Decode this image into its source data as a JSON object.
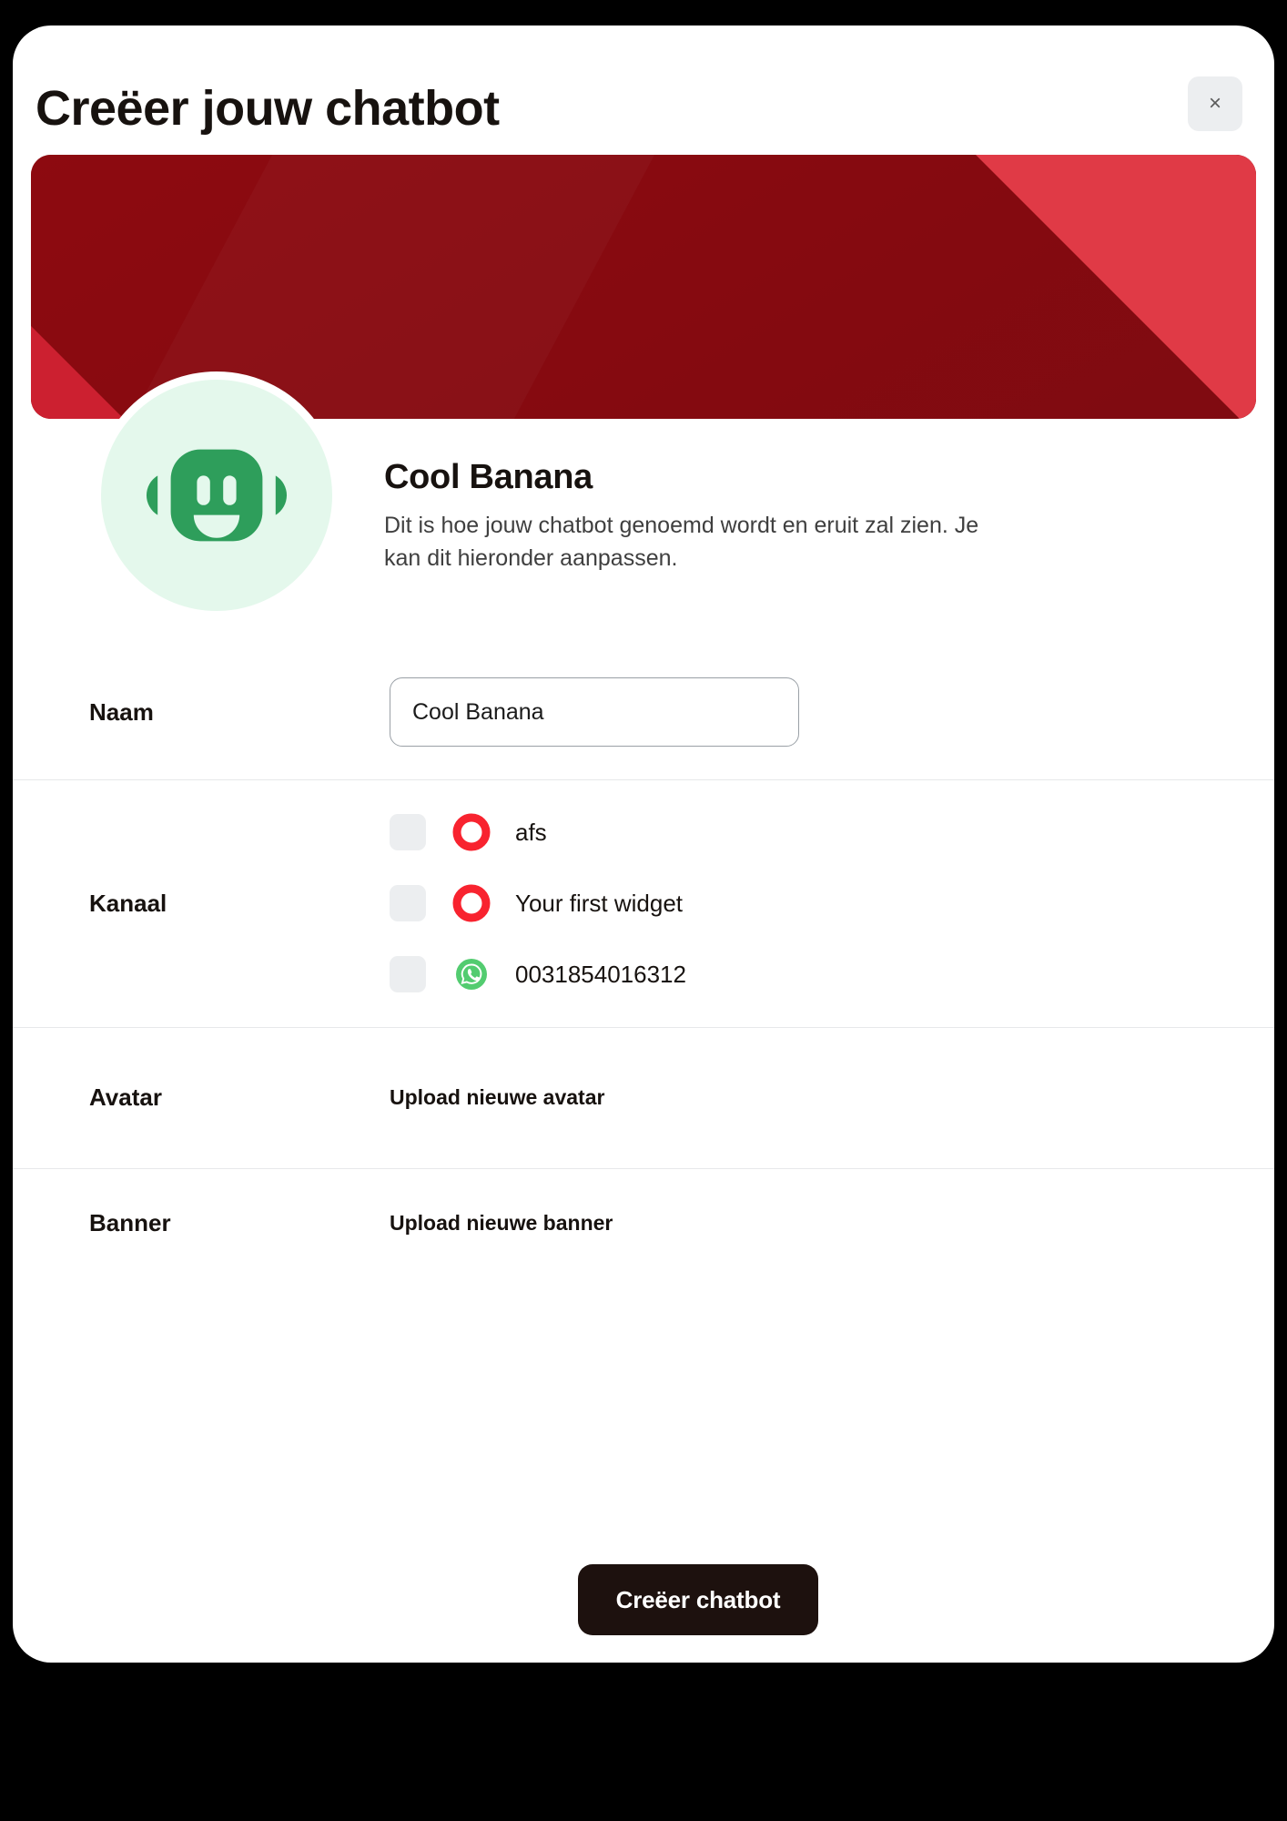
{
  "modal": {
    "title": "Creëer jouw chatbot",
    "close_label": "×",
    "close_icon": "close-icon"
  },
  "banner": {
    "base_color": "#8a0a10",
    "accent_color": "#e03a46",
    "accent_color_2": "#cc2030"
  },
  "identity": {
    "avatar_icon": "robot-icon",
    "avatar_bg_color": "#e4f8ec",
    "avatar_fg_color": "#2e9e5b",
    "name": "Cool Banana",
    "description_line_1": "Dit is hoe jouw chatbot genoemd wordt en eruit zal zien.",
    "description_line_2": "Je kan dit hieronder aanpassen."
  },
  "form": {
    "naam": {
      "label": "Naam",
      "value": "Cool Banana",
      "placeholder": "Cool Banana"
    },
    "kanaal": {
      "label": "Kanaal",
      "items": [
        {
          "label": "afs",
          "icon": "widget-icon",
          "icon_color": "#f8232f",
          "checked": false
        },
        {
          "label": "Your first widget",
          "icon": "widget-icon",
          "icon_color": "#f8232f",
          "checked": false
        },
        {
          "label": "0031854016312",
          "icon": "whatsapp-icon",
          "icon_color": "#53cc70",
          "checked": false
        }
      ]
    },
    "avatar": {
      "label": "Avatar",
      "upload_label": "Upload nieuwe avatar"
    },
    "banner": {
      "label": "Banner",
      "upload_label": "Upload nieuwe banner"
    }
  },
  "submit": {
    "label": "Creëer chatbot",
    "color": "#1d110e"
  }
}
